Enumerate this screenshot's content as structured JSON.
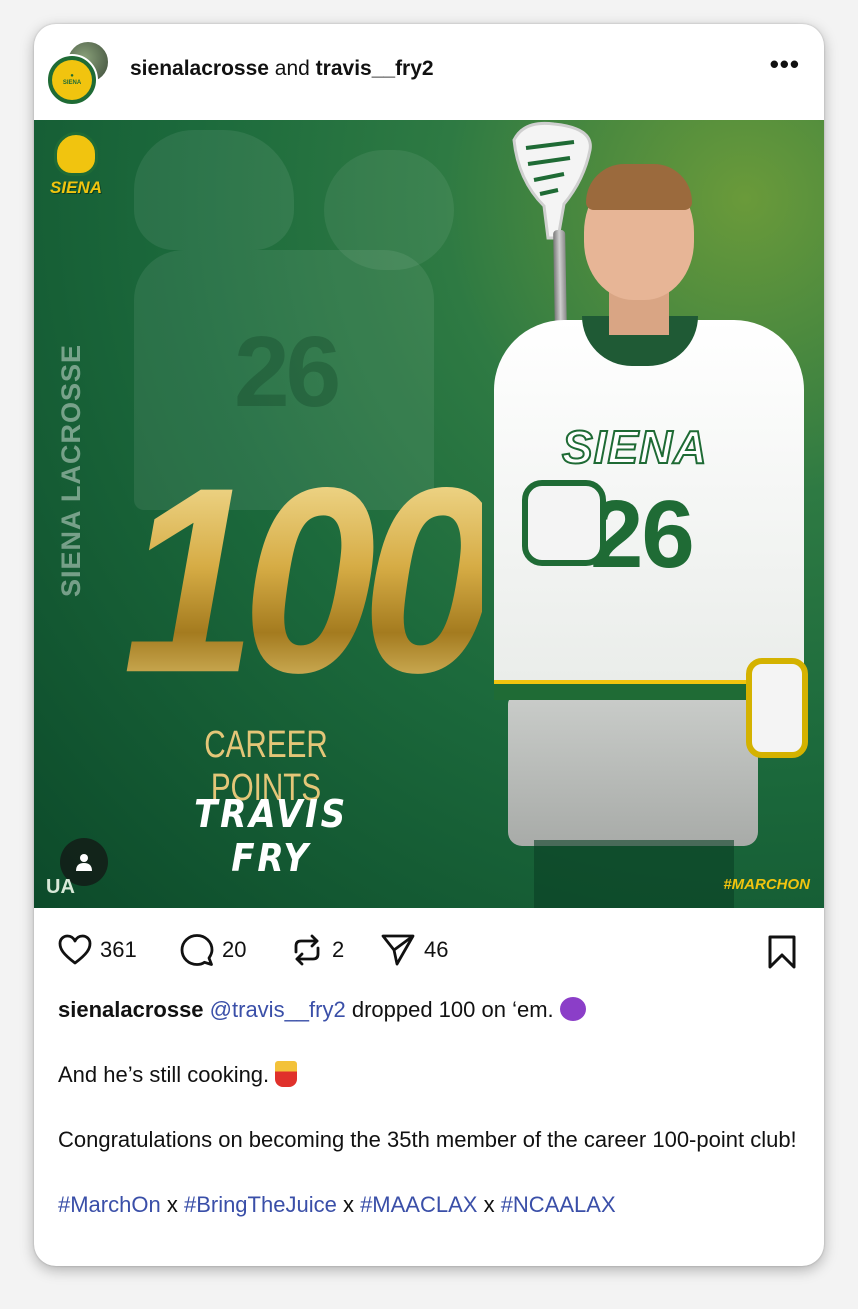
{
  "post": {
    "author_primary": "sienalacrosse",
    "author_joiner": "and",
    "author_secondary": "travis__fry2",
    "more_label": "•••"
  },
  "graphic": {
    "logo_text": "SIENA",
    "side_title": "SIENA LACROSSE",
    "big_number": "100",
    "subtitle": "CAREER POINTS",
    "player_name": "TRAVIS FRY",
    "jersey_text": "SIENA",
    "jersey_number": "26",
    "hashtag": "#MARCHON",
    "brand_mark": "UA"
  },
  "actions": {
    "likes": "361",
    "comments": "20",
    "reposts": "2",
    "shares": "46",
    "icons": [
      "heart-icon",
      "comment-icon",
      "repost-icon",
      "share-icon",
      "bookmark-icon"
    ]
  },
  "caption": {
    "username": "sienalacrosse",
    "mention": "@travis__fry2",
    "line1_text": " dropped 100 on ‘em. ",
    "line2_text": "And he’s still cooking. ",
    "line3_text": "Congratulations on becoming the 35th member of the career 100-point club!",
    "hashtags": [
      "#MarchOn",
      "#BringTheJuice",
      "#MAACLAX",
      "#NCAALAX"
    ],
    "separator": " x "
  },
  "colors": {
    "brand_green": "#1f6b35",
    "brand_gold": "#f1c40f",
    "link_blue": "#3a4fa8"
  }
}
